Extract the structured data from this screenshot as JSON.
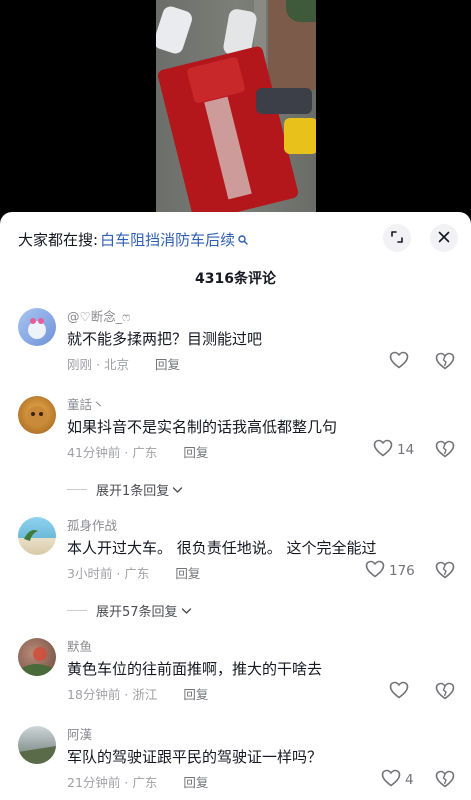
{
  "header": {
    "search_prefix": "大家都在搜:",
    "search_term": "白车阻挡消防车后续"
  },
  "comments_title": "4316条评论",
  "comments": [
    {
      "username": "@♡断念_ෆ",
      "text": "就不能多揉两把？目测能过吧",
      "time": "刚刚",
      "location": "北京",
      "reply_label": "回复",
      "likes": ""
    },
    {
      "username": "童話丶",
      "text": "如果抖音不是实名制的话我高低都整几句",
      "time": "41分钟前",
      "location": "广东",
      "reply_label": "回复",
      "likes": "14",
      "expand_label": "展开1条回复"
    },
    {
      "username": "孤身作战",
      "text": "本人开过大车。 很负责任地说。 这个完全能过",
      "time": "3小时前",
      "location": "广东",
      "reply_label": "回复",
      "likes": "176",
      "expand_label": "展开57条回复"
    },
    {
      "username": "默鱼",
      "text": "黄色车位的往前面推啊，推大的干啥去",
      "time": "18分钟前",
      "location": "浙江",
      "reply_label": "回复",
      "likes": ""
    },
    {
      "username": "阿漢",
      "text": "军队的驾驶证跟平民的驾驶证一样吗？",
      "time": "21分钟前",
      "location": "广东",
      "reply_label": "回复",
      "likes": "4"
    }
  ],
  "colors": {
    "link_blue": "#2f5fb3",
    "text_primary": "#161823",
    "text_secondary": "#8a8b91",
    "truck_red": "#b3161b"
  }
}
